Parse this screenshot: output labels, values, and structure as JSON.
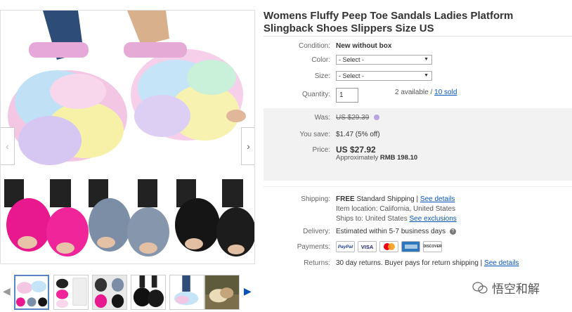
{
  "listing": {
    "title": "Womens Fluffy Peep Toe Sandals Ladies Platform Slingback Shoes Slippers Size US"
  },
  "gallery": {
    "prev_label": "‹",
    "next_label": "›",
    "thumb_prev": "◀",
    "thumb_next": "▶",
    "thumb_count": 6,
    "active_thumb_index": 0
  },
  "details": {
    "condition_label": "Condition:",
    "condition_value": "New without box",
    "color_label": "Color:",
    "color_value": "- Select -",
    "size_label": "Size:",
    "size_value": "- Select -",
    "quantity_label": "Quantity:",
    "quantity_value": "1",
    "available_text": "2 available /",
    "sold_link": "10 sold"
  },
  "pricing": {
    "was_label": "Was:",
    "was_value": "US $29.39",
    "you_save_label": "You save:",
    "you_save_value": "$1.47 (5% off)",
    "price_label": "Price:",
    "price_value": "US $27.92",
    "approx_prefix": "Approximately",
    "approx_value": "RMB 198.10"
  },
  "shipping": {
    "shipping_label": "Shipping:",
    "free": "FREE",
    "standard": "Standard Shipping |",
    "see_details": "See details",
    "item_location": "Item location: California, United States",
    "ships_to": "Ships to: United States",
    "see_exclusions": "See exclusions",
    "delivery_label": "Delivery:",
    "delivery_value": "Estimated within 5-7 business days",
    "payments_label": "Payments:",
    "returns_label": "Returns:",
    "returns_value": "30 day returns. Buyer pays for return shipping |",
    "returns_link": "See details"
  },
  "payments": {
    "paypal": "PayPal",
    "visa": "VISA",
    "discover": "DISCOVER"
  },
  "watermark": {
    "text": "悟空和解"
  },
  "colors": {
    "link": "#0654ba",
    "panel_bg": "#f2f2f2",
    "active_thumb_border": "#5a84c6"
  }
}
